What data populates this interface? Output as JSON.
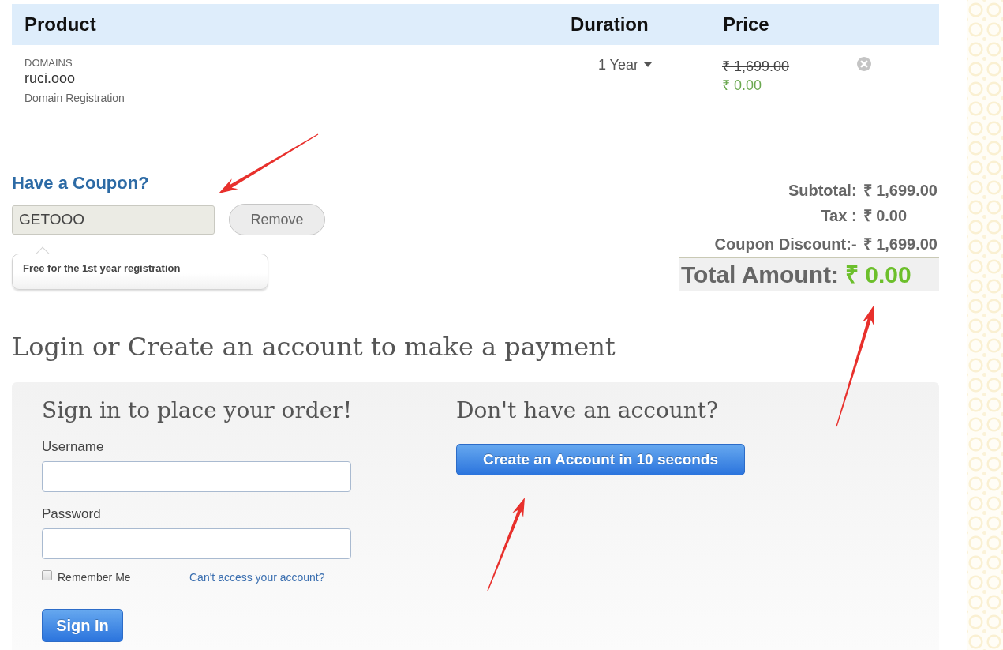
{
  "cart": {
    "columns": [
      {
        "label": "Product"
      },
      {
        "label": "Duration"
      },
      {
        "label": "Price"
      }
    ],
    "items": [
      {
        "category": "DOMAINS",
        "name": "ruci.ooo",
        "description": "Domain Registration",
        "duration": "1 Year",
        "original_price": "₹ 1,699.00",
        "price": "₹ 0.00"
      }
    ]
  },
  "coupon": {
    "heading": "Have a Coupon?",
    "value": "GETOOO",
    "button": "Remove",
    "note": "Free for the 1st year registration"
  },
  "totals": {
    "rows": [
      {
        "label": "Subtotal:",
        "value": "₹ 1,699.00"
      },
      {
        "label": "Tax :",
        "value": "₹ 0.00"
      },
      {
        "label": "Coupon Discount:-",
        "value": "₹ 1,699.00"
      }
    ],
    "total": {
      "label": "Total Amount:",
      "value": "₹ 0.00"
    }
  },
  "login": {
    "heading": "Login or Create an account to make a payment",
    "sign_in": {
      "heading": "Sign in to place your order!",
      "fields": [
        {
          "label": "Username"
        },
        {
          "label": "Password"
        }
      ],
      "remember_me": {
        "label": "Remember Me",
        "checked": false
      },
      "forgot_link": "Can't access your account?",
      "button": "Sign In"
    },
    "register": {
      "heading": "Don't have an account?",
      "button": "Create an Account in 10 seconds"
    }
  }
}
